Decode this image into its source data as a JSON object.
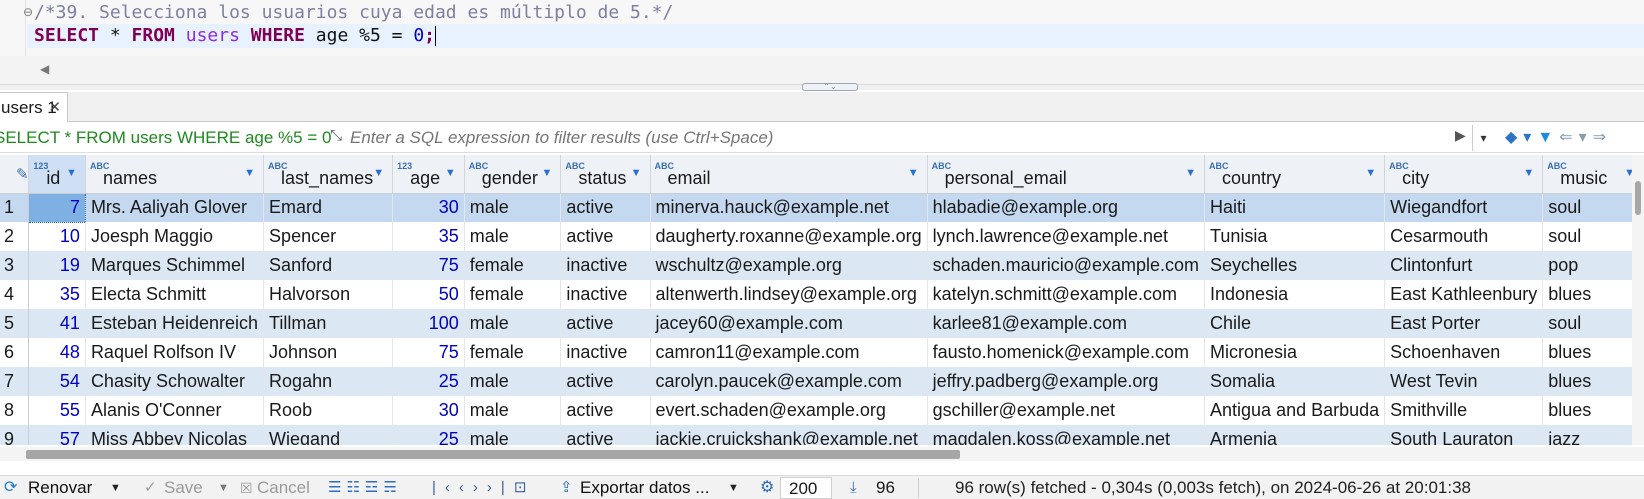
{
  "editor": {
    "comment": "/*39. Selecciona los usuarios cuya edad es múltiplo de 5.*/",
    "sql": {
      "kw_select": "SELECT",
      "star": " * ",
      "kw_from": "FROM",
      "table": " users ",
      "kw_where": "WHERE",
      "condition": " age %5 = ",
      "value": "0",
      "terminator": ";"
    }
  },
  "results_tab": {
    "label": "users 1",
    "close": "✕"
  },
  "filter": {
    "active_query": "SELECT * FROM users WHERE age %5 = 0",
    "placeholder": "Enter a SQL expression to filter results (use Ctrl+Space)"
  },
  "grid": {
    "columns": [
      {
        "name": "id",
        "type": "123"
      },
      {
        "name": "names",
        "type": "ABC"
      },
      {
        "name": "last_names",
        "type": "ABC"
      },
      {
        "name": "age",
        "type": "123"
      },
      {
        "name": "gender",
        "type": "ABC"
      },
      {
        "name": "status",
        "type": "ABC"
      },
      {
        "name": "email",
        "type": "ABC"
      },
      {
        "name": "personal_email",
        "type": "ABC"
      },
      {
        "name": "country",
        "type": "ABC"
      },
      {
        "name": "city",
        "type": "ABC"
      },
      {
        "name": "music",
        "type": "ABC"
      }
    ],
    "rows": [
      {
        "n": "1",
        "id": "7",
        "names": "Mrs. Aaliyah Glover",
        "last_names": "Emard",
        "age": "30",
        "gender": "male",
        "status": "active",
        "email": "minerva.hauck@example.net",
        "personal_email": "hlabadie@example.org",
        "country": "Haiti",
        "city": "Wiegandfort",
        "music": "soul"
      },
      {
        "n": "2",
        "id": "10",
        "names": "Joesph Maggio",
        "last_names": "Spencer",
        "age": "35",
        "gender": "male",
        "status": "active",
        "email": "daugherty.roxanne@example.org",
        "personal_email": "lynch.lawrence@example.net",
        "country": "Tunisia",
        "city": "Cesarmouth",
        "music": "soul"
      },
      {
        "n": "3",
        "id": "19",
        "names": "Marques Schimmel",
        "last_names": "Sanford",
        "age": "75",
        "gender": "female",
        "status": "inactive",
        "email": "wschultz@example.org",
        "personal_email": "schaden.mauricio@example.com",
        "country": "Seychelles",
        "city": "Clintonfurt",
        "music": "pop"
      },
      {
        "n": "4",
        "id": "35",
        "names": "Electa Schmitt",
        "last_names": "Halvorson",
        "age": "50",
        "gender": "female",
        "status": "inactive",
        "email": "altenwerth.lindsey@example.org",
        "personal_email": "katelyn.schmitt@example.com",
        "country": "Indonesia",
        "city": "East Kathleenbury",
        "music": "blues"
      },
      {
        "n": "5",
        "id": "41",
        "names": "Esteban Heidenreich",
        "last_names": "Tillman",
        "age": "100",
        "gender": "male",
        "status": "active",
        "email": "jacey60@example.com",
        "personal_email": "karlee81@example.com",
        "country": "Chile",
        "city": "East Porter",
        "music": "soul"
      },
      {
        "n": "6",
        "id": "48",
        "names": "Raquel Rolfson IV",
        "last_names": "Johnson",
        "age": "75",
        "gender": "female",
        "status": "inactive",
        "email": "camron11@example.com",
        "personal_email": "fausto.homenick@example.com",
        "country": "Micronesia",
        "city": "Schoenhaven",
        "music": "blues"
      },
      {
        "n": "7",
        "id": "54",
        "names": "Chasity Schowalter",
        "last_names": "Rogahn",
        "age": "25",
        "gender": "male",
        "status": "active",
        "email": "carolyn.paucek@example.com",
        "personal_email": "jeffry.padberg@example.org",
        "country": "Somalia",
        "city": "West Tevin",
        "music": "blues"
      },
      {
        "n": "8",
        "id": "55",
        "names": "Alanis O'Conner",
        "last_names": "Roob",
        "age": "30",
        "gender": "male",
        "status": "active",
        "email": "evert.schaden@example.org",
        "personal_email": "gschiller@example.net",
        "country": "Antigua and Barbuda",
        "city": "Smithville",
        "music": "blues"
      },
      {
        "n": "9",
        "id": "57",
        "names": "Miss Abbey Nicolas",
        "last_names": "Wiegand",
        "age": "25",
        "gender": "male",
        "status": "active",
        "email": "jackie.cruickshank@example.net",
        "personal_email": "magdalen.koss@example.net",
        "country": "Armenia",
        "city": "South Lauraton",
        "music": "jazz"
      }
    ]
  },
  "toolbar": {
    "refresh": "Renovar",
    "save": "Save",
    "cancel": "Cancel",
    "export": "Exportar datos ...",
    "fetch_size": "200",
    "row_count": "96",
    "message": "96 row(s) fetched - 0,304s (0,003s fetch), on 2024-06-26 at 20:01:38"
  }
}
